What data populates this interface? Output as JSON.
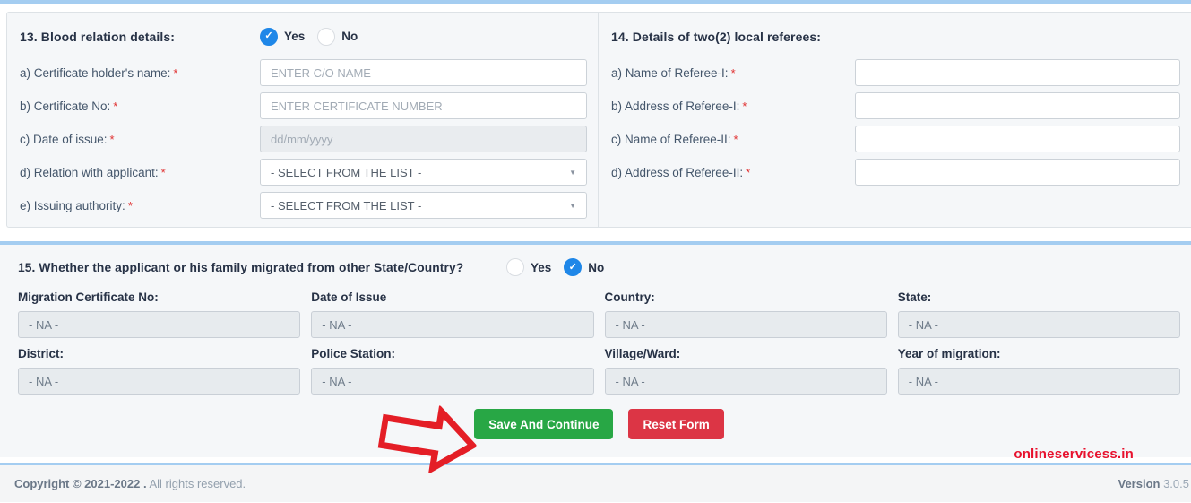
{
  "icons": {
    "check": "✓",
    "caret_down": "▼"
  },
  "required_marker": "*",
  "section13": {
    "heading": "13. Blood relation details:",
    "radio": {
      "yes_label": "Yes",
      "no_label": "No",
      "selected": "Yes"
    },
    "fields": [
      {
        "label": "a) Certificate holder's name:",
        "placeholder": "ENTER C/O NAME",
        "type": "text"
      },
      {
        "label": "b) Certificate No:",
        "placeholder": "ENTER CERTIFICATE NUMBER",
        "type": "text"
      },
      {
        "label": "c) Date of issue:",
        "placeholder": "dd/mm/yyyy",
        "type": "date-disabled"
      },
      {
        "label": "d) Relation with applicant:",
        "value": "- SELECT FROM THE LIST -",
        "type": "select"
      },
      {
        "label": "e) Issuing authority:",
        "value": "- SELECT FROM THE LIST -",
        "type": "select"
      }
    ]
  },
  "section14": {
    "heading": "14. Details of two(2) local referees:",
    "fields": [
      {
        "label": "a) Name of Referee-I:",
        "value": ""
      },
      {
        "label": "b) Address of Referee-I:",
        "value": ""
      },
      {
        "label": "c) Name of Referee-II:",
        "value": ""
      },
      {
        "label": "d) Address of Referee-II:",
        "value": ""
      }
    ]
  },
  "section15": {
    "question": "15. Whether the applicant or his family migrated from other State/Country?",
    "radio": {
      "yes_label": "Yes",
      "no_label": "No",
      "selected": "No"
    },
    "fields": [
      {
        "label": "Migration Certificate No:",
        "value": "- NA -"
      },
      {
        "label": "Date of Issue",
        "value": "- NA -"
      },
      {
        "label": "Country:",
        "value": "- NA -"
      },
      {
        "label": "State:",
        "value": "- NA -"
      },
      {
        "label": "District:",
        "value": "- NA -"
      },
      {
        "label": "Police Station:",
        "value": "- NA -"
      },
      {
        "label": "Village/Ward:",
        "value": "- NA -"
      },
      {
        "label": "Year of migration:",
        "value": "- NA -"
      }
    ]
  },
  "actions": {
    "save_label": "Save And Continue",
    "reset_label": "Reset Form",
    "save_color": "#28a745",
    "reset_color": "#dc3545"
  },
  "annotations": {
    "arrow_color": "#e41e26",
    "watermark": "onlineservicess.in",
    "watermark_color": "#e8112d"
  },
  "footer": {
    "copyright_bold": "Copyright © 2021-2022 .",
    "copyright_rest": "All rights reserved.",
    "version_label": "Version",
    "version_value": "3.0.5"
  }
}
